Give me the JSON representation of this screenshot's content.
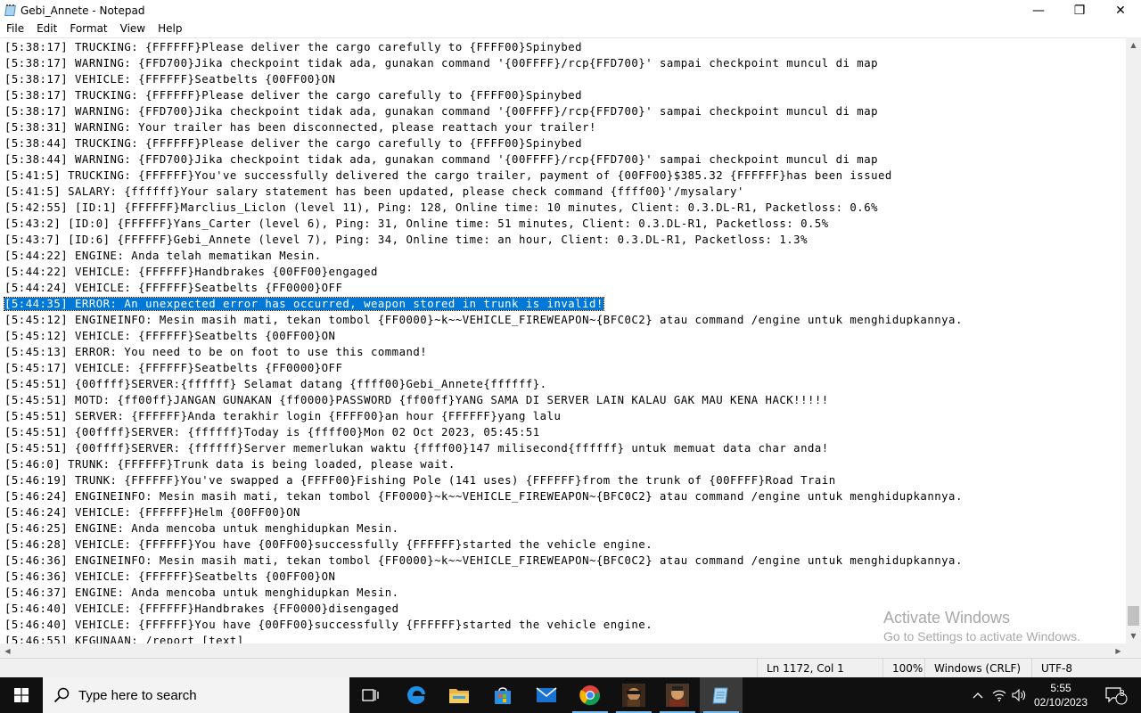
{
  "window": {
    "title": "Gebi_Annete - Notepad",
    "minimize": "—",
    "maximize": "❐",
    "close": "✕"
  },
  "menu": [
    "File",
    "Edit",
    "Format",
    "View",
    "Help"
  ],
  "lines": [
    "[5:38:17] TRUCKING: {FFFFFF}Please deliver the cargo carefully to {FFFF00}Spinybed",
    "[5:38:17] WARNING: {FFD700}Jika checkpoint tidak ada, gunakan command '{00FFFF}/rcp{FFD700}' sampai checkpoint muncul di map",
    "[5:38:17] VEHICLE: {FFFFFF}Seatbelts {00FF00}ON",
    "[5:38:17] TRUCKING: {FFFFFF}Please deliver the cargo carefully to {FFFF00}Spinybed",
    "[5:38:17] WARNING: {FFD700}Jika checkpoint tidak ada, gunakan command '{00FFFF}/rcp{FFD700}' sampai checkpoint muncul di map",
    "[5:38:31] WARNING: Your trailer has been disconnected, please reattach your trailer!",
    "[5:38:44] TRUCKING: {FFFFFF}Please deliver the cargo carefully to {FFFF00}Spinybed",
    "[5:38:44] WARNING: {FFD700}Jika checkpoint tidak ada, gunakan command '{00FFFF}/rcp{FFD700}' sampai checkpoint muncul di map",
    "[5:41:5] TRUCKING: {FFFFFF}You've successfully delivered the cargo trailer, payment of {00FF00}$385.32 {FFFFFF}has been issued",
    "[5:41:5] SALARY: {ffffff}Your salary statement has been updated, please check command {ffff00}'/mysalary'",
    "[5:42:55] [ID:1] {FFFFFF}Marclius_Liclon (level 11), Ping: 128, Online time: 10 minutes, Client: 0.3.DL-R1, Packetloss: 0.6%",
    "[5:43:2] [ID:0] {FFFFFF}Yans_Carter (level 6), Ping: 31, Online time: 51 minutes, Client: 0.3.DL-R1, Packetloss: 0.5%",
    "[5:43:7] [ID:6] {FFFFFF}Gebi_Annete (level 7), Ping: 34, Online time: an hour, Client: 0.3.DL-R1, Packetloss: 1.3%",
    "[5:44:22] ENGINE: Anda telah mematikan Mesin.",
    "[5:44:22] VEHICLE: {FFFFFF}Handbrakes {00FF00}engaged",
    "[5:44:24] VEHICLE: {FFFFFF}Seatbelts {FF0000}OFF",
    "[5:44:35] ERROR: An unexpected error has occurred, weapon stored in trunk is invalid!",
    "[5:45:12] ENGINEINFO: Mesin masih mati, tekan tombol {FF0000}~k~~VEHICLE_FIREWEAPON~{BFC0C2} atau command /engine untuk menghidupkannya.",
    "[5:45:12] VEHICLE: {FFFFFF}Seatbelts {00FF00}ON",
    "[5:45:13] ERROR: You need to be on foot to use this command!",
    "[5:45:17] VEHICLE: {FFFFFF}Seatbelts {FF0000}OFF",
    "[5:45:51] {00ffff}SERVER:{ffffff} Selamat datang {ffff00}Gebi_Annete{ffffff}.",
    "[5:45:51] MOTD: {ff00ff}JANGAN GUNAKAN {ff0000}PASSWORD {ff00ff}YANG SAMA DI SERVER LAIN KALAU GAK MAU KENA HACK!!!!!",
    "[5:45:51] SERVER: {FFFFFF}Anda terakhir login {FFFF00}an hour {FFFFFF}yang lalu",
    "[5:45:51] {00ffff}SERVER: {ffffff}Today is {ffff00}Mon 02 Oct 2023, 05:45:51",
    "[5:45:51] {00ffff}SERVER: {ffffff}Server memerlukan waktu {ffff00}147 milisecond{ffffff} untuk memuat data char anda!",
    "[5:46:0] TRUNK: {FFFFFF}Trunk data is being loaded, please wait.",
    "[5:46:19] TRUNK: {FFFFFF}You've swapped a {FFFF00}Fishing Pole (141 uses) {FFFFFF}from the trunk of {00FFFF}Road Train",
    "[5:46:24] ENGINEINFO: Mesin masih mati, tekan tombol {FF0000}~k~~VEHICLE_FIREWEAPON~{BFC0C2} atau command /engine untuk menghidupkannya.",
    "[5:46:24] VEHICLE: {FFFFFF}Helm {00FF00}ON",
    "[5:46:25] ENGINE: Anda mencoba untuk menghidupkan Mesin.",
    "[5:46:28] VEHICLE: {FFFFFF}You have {00FF00}successfully {FFFFFF}started the vehicle engine.",
    "[5:46:36] ENGINEINFO: Mesin masih mati, tekan tombol {FF0000}~k~~VEHICLE_FIREWEAPON~{BFC0C2} atau command /engine untuk menghidupkannya.",
    "[5:46:36] VEHICLE: {FFFFFF}Seatbelts {00FF00}ON",
    "[5:46:37] ENGINE: Anda mencoba untuk menghidupkan Mesin.",
    "[5:46:40] VEHICLE: {FFFFFF}Handbrakes {FF0000}disengaged",
    "[5:46:40] VEHICLE: {FFFFFF}You have {00FF00}successfully {FFFFFF}started the vehicle engine.",
    "[5:46:55] KEGUNAAN: /report [text]"
  ],
  "selected_line_index": 16,
  "status": {
    "position": "Ln 1172, Col 1",
    "zoom": "100%",
    "line_ending": "Windows (CRLF)",
    "encoding": "UTF-8"
  },
  "watermark": {
    "title": "Activate Windows",
    "subtitle": "Go to Settings to activate Windows."
  },
  "taskbar": {
    "search_placeholder": "Type here to search",
    "time": "5:55",
    "date": "02/10/2023",
    "notification_count": "3",
    "icons": [
      "windows-start-icon",
      "task-view-icon",
      "edge-icon",
      "file-explorer-icon",
      "store-icon",
      "mail-icon",
      "chrome-icon",
      "game-icon",
      "game-icon-2",
      "notepad-icon"
    ]
  },
  "colors": {
    "selection": "#0078d7",
    "taskbar": "#101010",
    "statusbar": "#f0f0f0"
  }
}
